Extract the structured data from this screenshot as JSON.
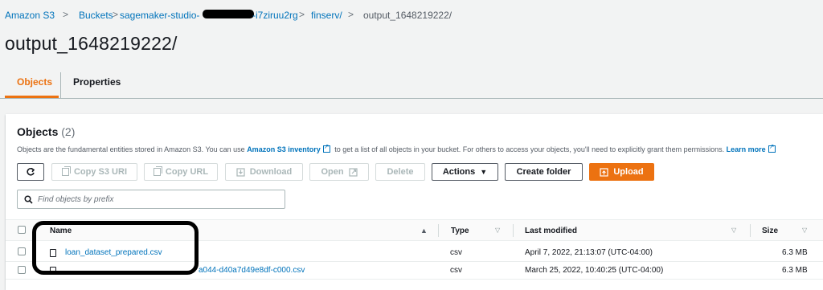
{
  "breadcrumb": {
    "items": [
      "Amazon S3",
      "Buckets",
      "sagemaker-studio-",
      "-i7ziruu2rg",
      "finserv/",
      "output_1648219222/"
    ],
    "separator": ">"
  },
  "page": {
    "title": "output_1648219222/"
  },
  "tabs": [
    "Objects",
    "Properties"
  ],
  "objects_panel": {
    "title": "Objects",
    "count": "(2)",
    "description_pre": "Objects are the fundamental entities stored in Amazon S3. You can use ",
    "description_link1": "Amazon S3 inventory",
    "description_mid": " to get a list of all objects in your bucket. For others to access your objects, you'll need to explicitly grant them permissions. ",
    "description_link2": "Learn more"
  },
  "toolbar": {
    "refresh_icon": "refresh-icon",
    "copy_s3_uri": "Copy S3 URI",
    "copy_url": "Copy URL",
    "download": "Download",
    "open": "Open",
    "delete": "Delete",
    "actions": "Actions",
    "create_folder": "Create folder",
    "upload": "Upload"
  },
  "search": {
    "placeholder": "Find objects by prefix"
  },
  "table": {
    "columns": [
      "Name",
      "Type",
      "Last modified",
      "Size"
    ],
    "rows": [
      {
        "name": "loan_dataset_prepared.csv",
        "type": "csv",
        "last_modified": "April 7, 2022, 21:13:07 (UTC-04:00)",
        "size": "6.3 MB"
      },
      {
        "name": "a044-d40a7d49e8df-c000.csv",
        "type": "csv",
        "last_modified": "March 25, 2022, 10:40:25 (UTC-04:00)",
        "size": "6.3 MB"
      }
    ]
  },
  "colors": {
    "accent": "#ec7211",
    "link": "#0073bb",
    "text": "#16191f",
    "annotation": "#000000"
  }
}
